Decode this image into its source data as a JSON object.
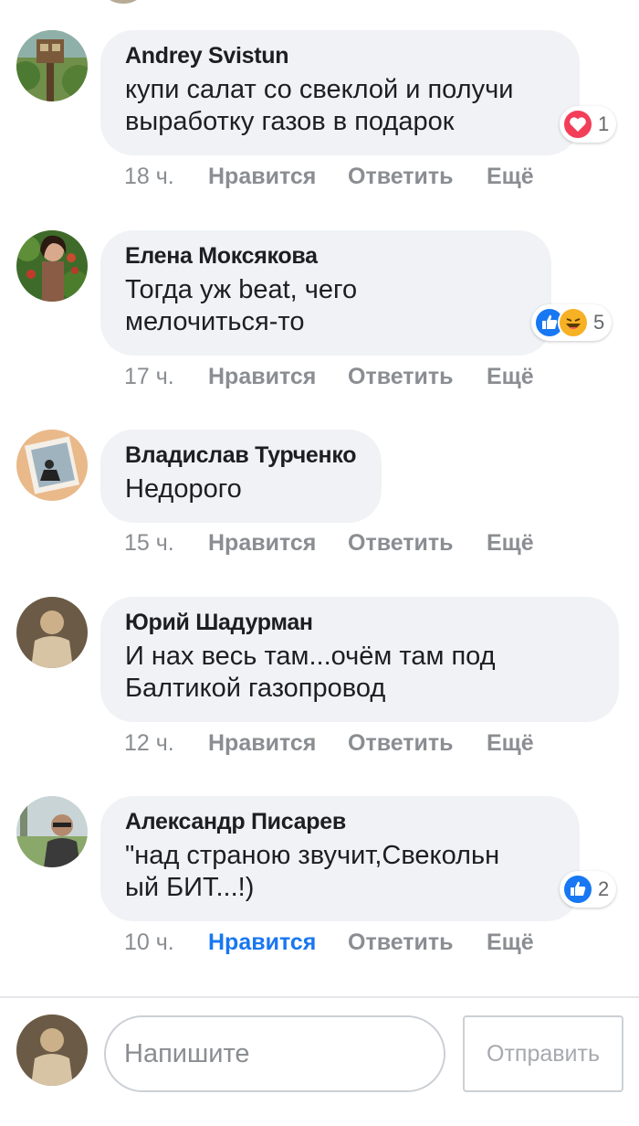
{
  "comments": [
    {
      "author": "Andrey Svistun",
      "text": "купи салат со свеклой и получи\nвыработку газов в подарок",
      "time": "18 ч.",
      "like_label": "Нравится",
      "reply_label": "Ответить",
      "more_label": "Ещё",
      "reactions": [
        "love"
      ],
      "reaction_count": "1",
      "liked": false
    },
    {
      "author": "Елена Моксякова",
      "text": "Тогда уж beat, чего\nмелочиться-то",
      "time": "17 ч.",
      "like_label": "Нравится",
      "reply_label": "Ответить",
      "more_label": "Ещё",
      "reactions": [
        "like",
        "haha"
      ],
      "reaction_count": "5",
      "liked": false
    },
    {
      "author": "Владислав Турченко",
      "text": "Недорого",
      "time": "15 ч.",
      "like_label": "Нравится",
      "reply_label": "Ответить",
      "more_label": "Ещё",
      "reactions": [],
      "reaction_count": "",
      "liked": false
    },
    {
      "author": "Юрий Шадурман",
      "text": "И нах весь там...очём там под\nБалтикой газопровод",
      "time": "12 ч.",
      "like_label": "Нравится",
      "reply_label": "Ответить",
      "more_label": "Ещё",
      "reactions": [],
      "reaction_count": "",
      "liked": false
    },
    {
      "author": "Александр Писарев",
      "text": "\"над страною звучит,Свекольн\nый БИТ...!)",
      "time": "10 ч.",
      "like_label": "Нравится",
      "reply_label": "Ответить",
      "more_label": "Ещё",
      "reactions": [
        "like"
      ],
      "reaction_count": "2",
      "liked": true
    }
  ],
  "compose": {
    "placeholder": "Напишите",
    "send_label": "Отправить"
  },
  "colors": {
    "bubble": "#f0f2f5",
    "meta": "#8a8d91",
    "liked": "#1877f2",
    "love": "#f33e58",
    "like": "#1877f2",
    "haha": "#f7b125"
  }
}
